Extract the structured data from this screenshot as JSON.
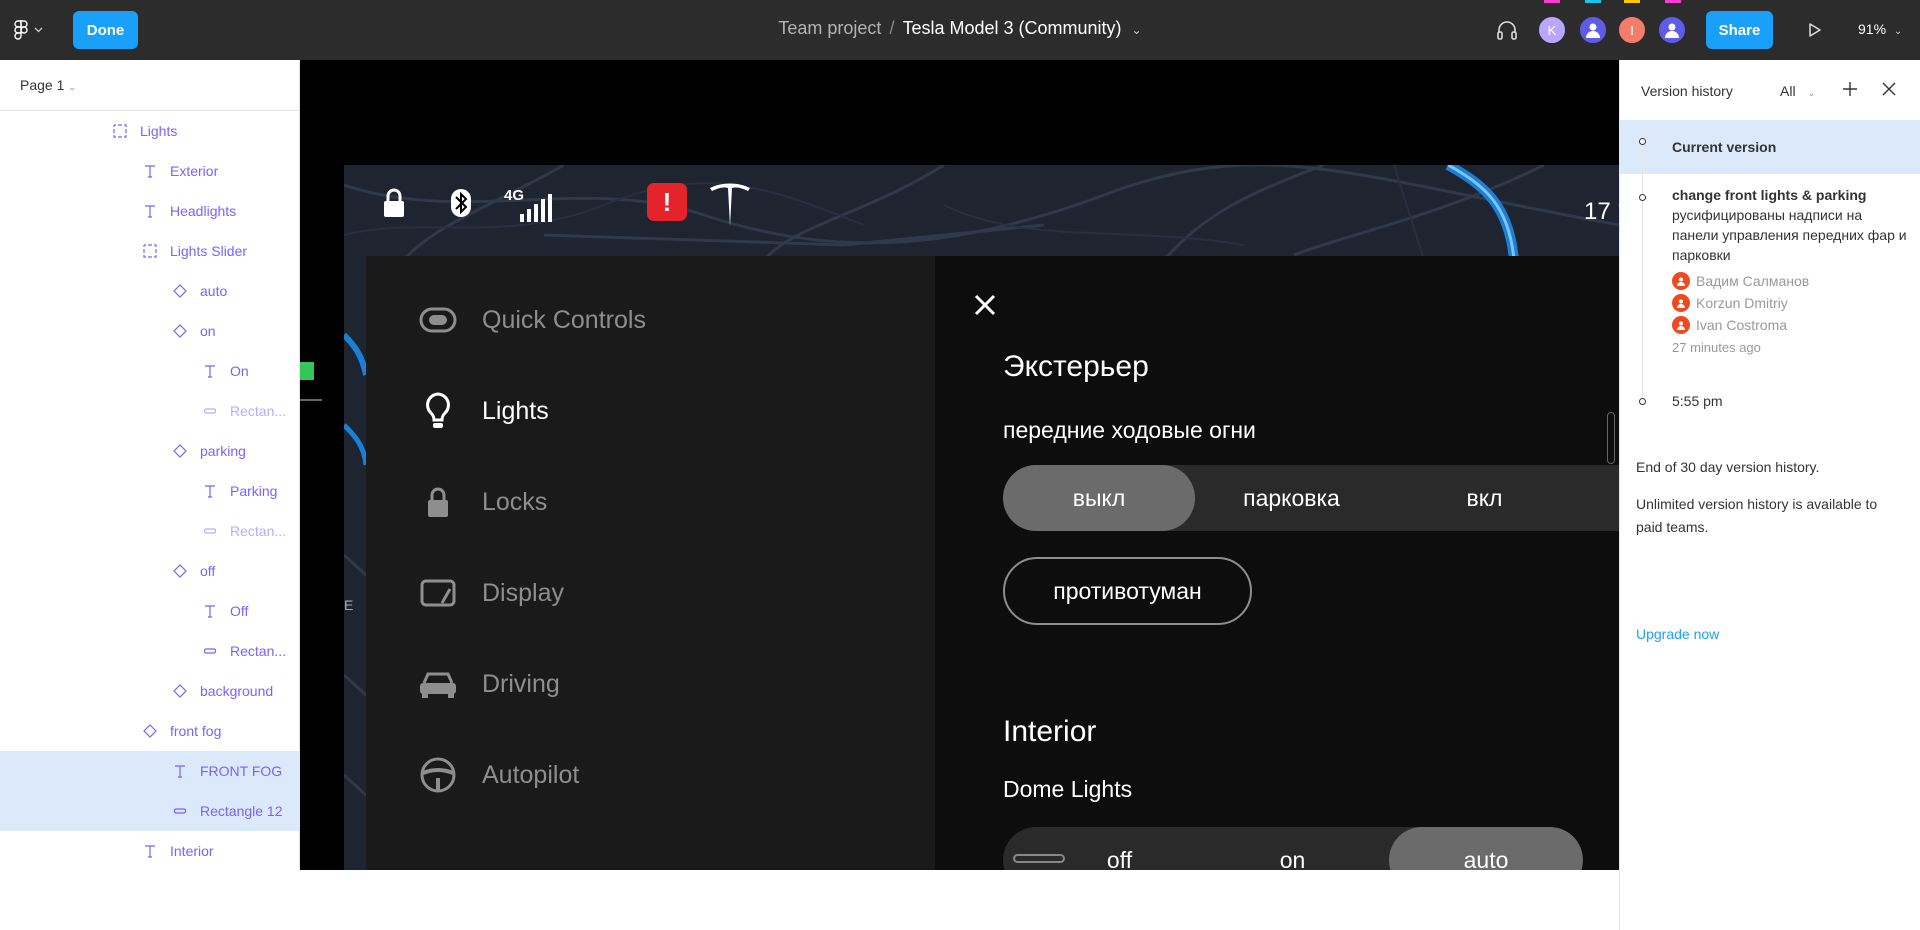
{
  "toolbar": {
    "done_label": "Done",
    "project": "Team project",
    "separator": "/",
    "file_name": "Tesla Model 3 (Community)",
    "share_label": "Share",
    "zoom": "91%",
    "avatars": [
      {
        "initial": "K",
        "color": "#b9a6ff"
      },
      {
        "initial": "",
        "color": "#5e5ce6"
      },
      {
        "initial": "I",
        "color": "#f47c6a"
      },
      {
        "initial": "",
        "color": "#5e5ce6"
      }
    ],
    "swatches": [
      "#ff3dd3",
      "#1bc4e6",
      "#ffc700",
      "#ff3dd3"
    ]
  },
  "layers": {
    "page_label": "Page 1",
    "items": [
      {
        "label": "Lights",
        "icon": "frame-icon",
        "indent": 110,
        "state": ""
      },
      {
        "label": "Exterior",
        "icon": "text-icon",
        "indent": 140,
        "state": ""
      },
      {
        "label": "Headlights",
        "icon": "text-icon",
        "indent": 140,
        "state": ""
      },
      {
        "label": "Lights Slider",
        "icon": "frame-icon",
        "indent": 140,
        "state": ""
      },
      {
        "label": "auto",
        "icon": "instance-icon",
        "indent": 170,
        "state": ""
      },
      {
        "label": "on",
        "icon": "instance-icon",
        "indent": 170,
        "state": ""
      },
      {
        "label": "On",
        "icon": "text-icon",
        "indent": 200,
        "state": ""
      },
      {
        "label": "Rectan...",
        "icon": "rectangle-icon",
        "indent": 200,
        "state": "faded"
      },
      {
        "label": "parking",
        "icon": "instance-icon",
        "indent": 170,
        "state": ""
      },
      {
        "label": "Parking",
        "icon": "text-icon",
        "indent": 200,
        "state": ""
      },
      {
        "label": "Rectan...",
        "icon": "rectangle-icon",
        "indent": 200,
        "state": "faded"
      },
      {
        "label": "off",
        "icon": "instance-icon",
        "indent": 170,
        "state": ""
      },
      {
        "label": "Off",
        "icon": "text-icon",
        "indent": 200,
        "state": ""
      },
      {
        "label": "Rectan...",
        "icon": "rectangle-icon",
        "indent": 200,
        "state": ""
      },
      {
        "label": "background",
        "icon": "instance-icon",
        "indent": 170,
        "state": ""
      },
      {
        "label": "front fog",
        "icon": "instance-icon",
        "indent": 140,
        "state": ""
      },
      {
        "label": "FRONT FOG",
        "icon": "text-icon",
        "indent": 170,
        "state": "selected"
      },
      {
        "label": "Rectangle 12",
        "icon": "rectangle-icon",
        "indent": 170,
        "state": "selected"
      },
      {
        "label": "Interior",
        "icon": "text-icon",
        "indent": 140,
        "state": ""
      }
    ]
  },
  "canvas": {
    "status": {
      "network": "4G",
      "temperature": "17 °"
    },
    "menu": [
      {
        "label": "Quick Controls",
        "icon": "toggle-icon",
        "active": false
      },
      {
        "label": "Lights",
        "icon": "bulb-icon",
        "active": true
      },
      {
        "label": "Locks",
        "icon": "lock-icon",
        "active": false
      },
      {
        "label": "Display",
        "icon": "display-icon",
        "active": false
      },
      {
        "label": "Driving",
        "icon": "car-icon",
        "active": false
      },
      {
        "label": "Autopilot",
        "icon": "steering-wheel-icon",
        "active": false
      }
    ],
    "exterior_heading": "Экстерьер",
    "exterior_sub": "передние  ходовые огни",
    "exterior_options": [
      "выкл",
      "парковка",
      "вкл"
    ],
    "exterior_selected": 0,
    "fog_button": "противотуман",
    "interior_heading": "Interior",
    "interior_sub": "Dome Lights",
    "dome_options": [
      "off",
      "on",
      "auto"
    ],
    "dome_selected": 2
  },
  "version_history": {
    "title": "Version history",
    "filter": "All",
    "current_label": "Current version",
    "entry": {
      "title": "change front lights & parking",
      "description": "русифицированы надписи на панели управления передних фар и парковки",
      "authors": [
        "Вадим Салманов",
        "Korzun Dmitriy",
        "Ivan Costroma"
      ],
      "time": "27 minutes ago"
    },
    "older_time": "5:55 pm",
    "end_note": "End of 30 day version history.",
    "upgrade_note": "Unlimited version history is available to paid teams.",
    "upgrade_link": "Upgrade now"
  }
}
